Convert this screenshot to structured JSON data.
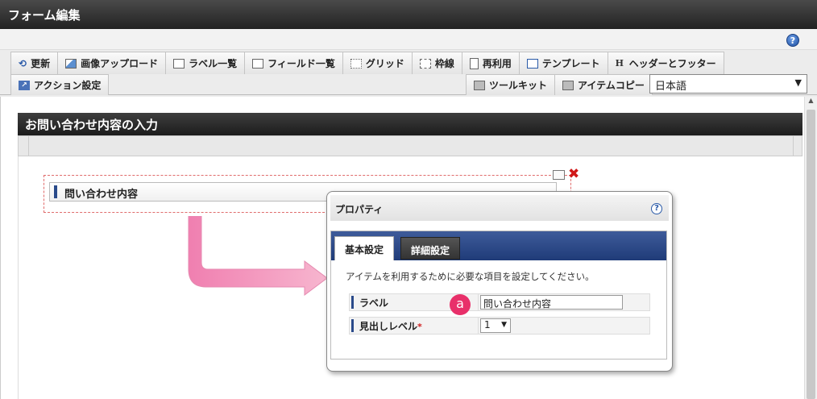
{
  "window": {
    "title": "フォーム編集"
  },
  "toolbar": {
    "row1": [
      {
        "label": "更新",
        "icon": "refresh-icon"
      },
      {
        "label": "画像アップロード",
        "icon": "image-upload-icon"
      },
      {
        "label": "ラベル一覧",
        "icon": "label-list-icon"
      },
      {
        "label": "フィールド一覧",
        "icon": "field-list-icon"
      },
      {
        "label": "グリッド",
        "icon": "grid-icon"
      },
      {
        "label": "枠線",
        "icon": "border-icon"
      },
      {
        "label": "再利用",
        "icon": "reuse-icon"
      },
      {
        "label": "テンプレート",
        "icon": "template-icon"
      },
      {
        "label": "ヘッダーとフッター",
        "icon": "header-footer-icon"
      }
    ],
    "action_settings": "アクション設定",
    "toolkit": "ツールキット",
    "item_copy": "アイテムコピー",
    "language": "日本語"
  },
  "section": {
    "title": "お問い合わせ内容の入力"
  },
  "item": {
    "label": "問い合わせ内容"
  },
  "dialog": {
    "title": "プロパティ",
    "tabs": {
      "basic": "基本設定",
      "detail": "詳細設定"
    },
    "description": "アイテムを利用するために必要な項目を設定してください。",
    "fields": {
      "label_name": "ラベル",
      "label_value": "問い合わせ内容",
      "heading_level_name": "見出しレベル",
      "required_mark": "*",
      "heading_level_value": "1"
    }
  },
  "callout": {
    "badge": "a"
  },
  "colors": {
    "accent_blue": "#2a4a8a",
    "badge_pink": "#e8306a",
    "close_red": "#d01818"
  }
}
